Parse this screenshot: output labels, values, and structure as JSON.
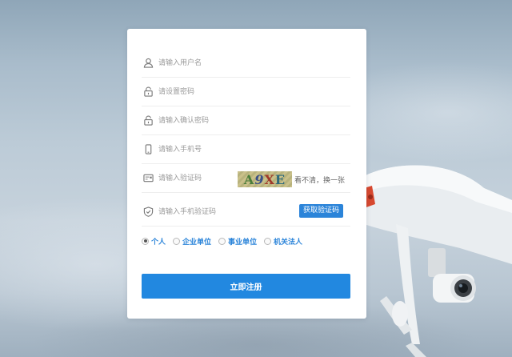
{
  "form": {
    "username": {
      "placeholder": "请输入用户名",
      "value": "",
      "icon": "user-icon"
    },
    "password": {
      "placeholder": "请设置密码",
      "value": "",
      "icon": "lock-icon"
    },
    "confirm_password": {
      "placeholder": "请输入确认密码",
      "value": "",
      "icon": "lock-icon"
    },
    "phone": {
      "placeholder": "请输入手机号",
      "value": "",
      "icon": "phone-icon"
    },
    "captcha": {
      "placeholder": "请输入验证码",
      "value": "",
      "icon": "captcha-icon",
      "image_text": [
        "A",
        "9",
        "X",
        "E"
      ],
      "refresh_label": "看不清，换一张"
    },
    "sms_code": {
      "placeholder": "请输入手机验证码",
      "value": "",
      "icon": "shield-check-icon",
      "button_label": "获取验证码"
    },
    "user_types": [
      {
        "label": "个人",
        "checked": true
      },
      {
        "label": "企业单位",
        "checked": false
      },
      {
        "label": "事业单位",
        "checked": false
      },
      {
        "label": "机关法人",
        "checked": false
      }
    ],
    "submit_label": "立即注册"
  },
  "colors": {
    "accent": "#2288e0",
    "link": "#2b84d9",
    "placeholder": "#9a9a9a",
    "divider": "#eeeeee"
  }
}
